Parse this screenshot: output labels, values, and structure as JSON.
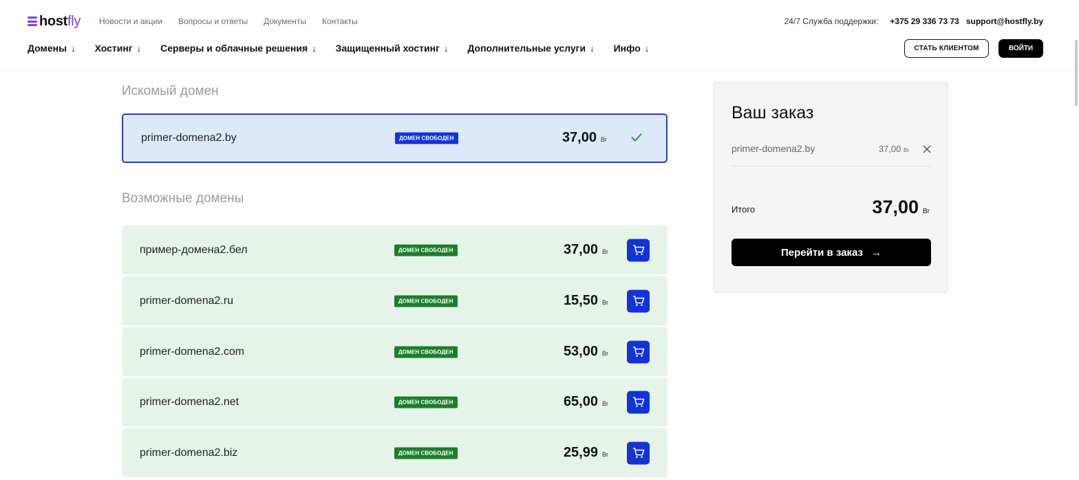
{
  "header": {
    "logo": {
      "part1": "host",
      "part2": "fly"
    },
    "top_links": [
      "Новости и акции",
      "Вопросы и ответы",
      "Документы",
      "Контакты"
    ],
    "support_label": "24/7 Служба поддержки:",
    "support_phone": "+375 29 336 73 73",
    "support_email": "support@hostfly.by",
    "nav": [
      "Домены",
      "Хостинг",
      "Серверы и облачные решения",
      "Защищенный хостинг",
      "Дополнительные услуги",
      "Инфо"
    ],
    "btn_client": "СТАТЬ КЛИЕНТОМ",
    "btn_login": "ВОЙТИ"
  },
  "searched": {
    "title": "Искомый домен",
    "domain": "primer-domena2.by",
    "badge": "ДОМЕН СВОБОДЕН",
    "price": "37,00",
    "currency": "Br"
  },
  "possible": {
    "title": "Возможные домены",
    "items": [
      {
        "domain": "пример-домена2.бел",
        "badge": "ДОМЕН СВОБОДЕН",
        "price": "37,00"
      },
      {
        "domain": "primer-domena2.ru",
        "badge": "ДОМЕН СВОБОДЕН",
        "price": "15,50"
      },
      {
        "domain": "primer-domena2.com",
        "badge": "ДОМЕН СВОБОДЕН",
        "price": "53,00"
      },
      {
        "domain": "primer-domena2.net",
        "badge": "ДОМЕН СВОБОДЕН",
        "price": "65,00"
      },
      {
        "domain": "primer-domena2.biz",
        "badge": "ДОМЕН СВОБОДЕН",
        "price": "25,99"
      }
    ]
  },
  "order": {
    "title": "Ваш заказ",
    "item_domain": "primer-domena2.by",
    "item_price": "37,00",
    "total_label": "Итого",
    "total_value": "37,00",
    "checkout": "Перейти в заказ",
    "checkout_arrow": "→"
  },
  "icons": {
    "cart": "cart-icon",
    "check": "check-icon",
    "close": "close-icon",
    "arrow_down": "arrow-down-icon"
  },
  "colors": {
    "brand_purple": "#7b3fe4",
    "cart_blue": "#1233d6",
    "available_green": "#1a7f2a",
    "selected_bg": "#dde8f8",
    "selected_border": "#2443b8",
    "row_bg": "#e6f3e8"
  }
}
